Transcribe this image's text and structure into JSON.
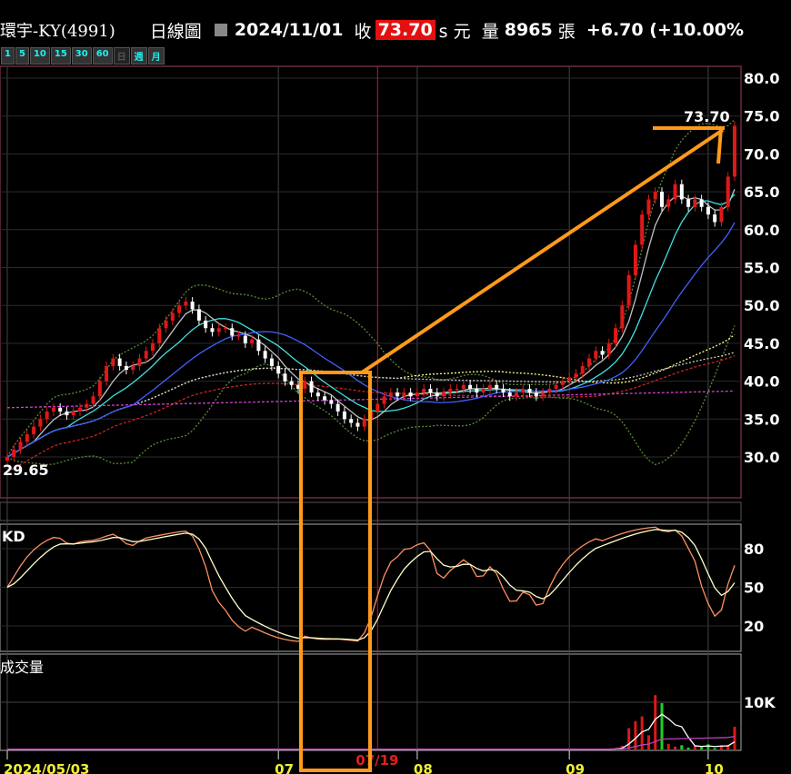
{
  "header": {
    "name": "環宇-KY(4991)",
    "chart_type": "日線圖",
    "date": "2024/11/01",
    "close_label": "收",
    "close": "73.70",
    "unit": "s 元",
    "vol_label": "量",
    "volume": "8965",
    "vol_unit": "張",
    "change": "+6.70 (+10.00%"
  },
  "timeframes": [
    "1",
    "5",
    "10",
    "15",
    "30",
    "60",
    "日",
    "週",
    "月"
  ],
  "chart_data": [
    {
      "type": "candlestick",
      "title": "Price",
      "ylim": [
        25,
        82
      ],
      "yticks": [
        "80.0",
        "75.0",
        "70.0",
        "65.0",
        "60.0",
        "55.0",
        "50.0",
        "45.0",
        "40.0",
        "35.0",
        "30.0"
      ],
      "yvals": [
        80,
        75,
        70,
        65,
        60,
        55,
        50,
        45,
        40,
        35,
        30
      ],
      "high_label": "73.70",
      "low_label": "29.65",
      "xticks": [
        {
          "label": "2024/05/03",
          "i": 0
        },
        {
          "label": "07",
          "i": 41
        },
        {
          "label": "08",
          "i": 62
        },
        {
          "label": "09",
          "i": 85
        },
        {
          "label": "10",
          "i": 106
        }
      ],
      "highlight_date": "07/19",
      "highlight_i": 56,
      "closes": [
        30,
        31,
        32,
        33,
        34,
        35,
        36,
        36.5,
        36,
        35.5,
        36,
        36.5,
        37,
        38,
        40,
        42,
        43,
        42,
        41.5,
        42,
        43,
        44,
        45,
        47,
        48,
        49,
        50,
        50.5,
        49.5,
        48,
        47,
        46.5,
        47,
        47,
        46,
        46,
        45,
        45.5,
        44,
        43,
        42,
        41,
        40,
        39.5,
        39,
        40,
        38.5,
        38,
        37.5,
        37,
        36,
        35,
        34.5,
        34,
        35,
        36,
        37,
        38,
        38.5,
        38,
        38.5,
        38,
        38.5,
        39,
        38.5,
        38,
        38.5,
        39,
        39,
        39.5,
        39,
        38.5,
        39,
        39.5,
        39,
        38.5,
        38,
        38.5,
        39,
        38.5,
        38,
        38.5,
        39,
        39.5,
        40,
        40.5,
        41,
        42,
        43,
        44,
        43.5,
        45,
        47,
        50,
        54,
        58,
        62,
        64,
        65,
        63,
        64,
        66,
        64,
        63,
        64,
        63,
        62,
        61,
        63,
        67,
        73.7
      ]
    },
    {
      "type": "line",
      "title": "KD",
      "yticks": [
        "80",
        "50",
        "20"
      ],
      "yvals": [
        80,
        50,
        20
      ],
      "ylim": [
        0,
        100
      ]
    },
    {
      "type": "bar",
      "title": "成交量",
      "yticks": [
        "10K"
      ],
      "yvals": [
        10000
      ],
      "volumes_tail": [
        300,
        800,
        4500,
        6000,
        7000,
        3000,
        11500,
        9800,
        1200,
        600,
        900,
        400,
        800,
        500,
        1100,
        300,
        900,
        1000,
        4800
      ]
    }
  ],
  "annotation": {
    "target_label": "73.70"
  }
}
